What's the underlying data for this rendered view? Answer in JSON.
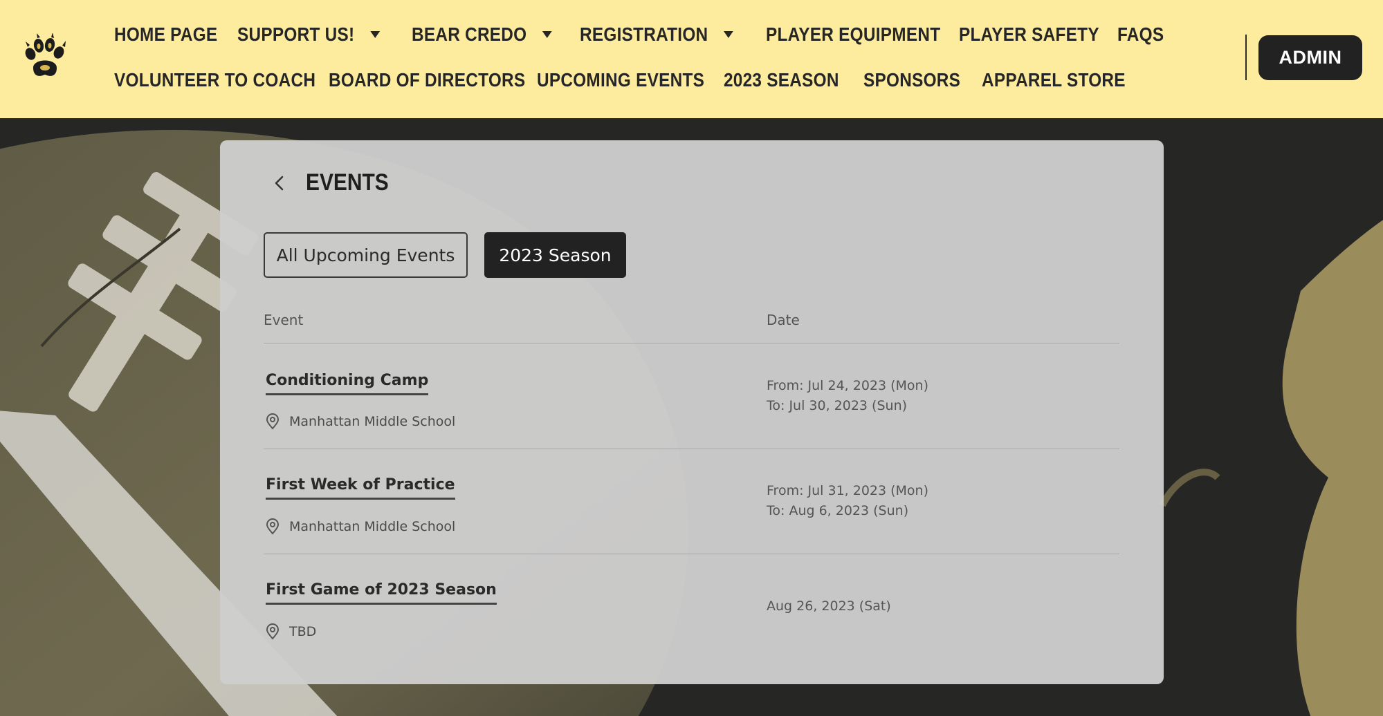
{
  "nav": {
    "row1": [
      {
        "label": "HOME PAGE",
        "dropdown": false
      },
      {
        "label": "SUPPORT US!",
        "dropdown": true
      },
      {
        "label": "BEAR CREDO",
        "dropdown": true
      },
      {
        "label": "REGISTRATION",
        "dropdown": true
      },
      {
        "label": "PLAYER EQUIPMENT",
        "dropdown": false
      },
      {
        "label": "PLAYER SAFETY",
        "dropdown": false
      },
      {
        "label": "FAQS",
        "dropdown": false
      }
    ],
    "row2": [
      {
        "label": "VOLUNTEER TO COACH"
      },
      {
        "label": "BOARD OF DIRECTORS"
      },
      {
        "label": "UPCOMING EVENTS"
      },
      {
        "label": "2023 SEASON"
      },
      {
        "label": "SPONSORS"
      },
      {
        "label": "APPAREL STORE"
      }
    ],
    "admin_label": "ADMIN"
  },
  "events": {
    "title": "EVENTS",
    "tabs": [
      {
        "label": "All Upcoming Events",
        "active": false
      },
      {
        "label": "2023 Season",
        "active": true
      }
    ],
    "columns": {
      "event": "Event",
      "date": "Date"
    },
    "rows": [
      {
        "name": "Conditioning Camp",
        "location": "Manhattan Middle School",
        "date_from": "From: Jul 24, 2023 (Mon)",
        "date_to": "To: Jul 30, 2023 (Sun)"
      },
      {
        "name": "First Week of Practice",
        "location": "Manhattan Middle School",
        "date_from": "From: Jul 31, 2023 (Mon)",
        "date_to": "To: Aug 6, 2023 (Sun)"
      },
      {
        "name": "First Game of 2023 Season",
        "location": "TBD",
        "date_single": "Aug 26, 2023 (Sat)"
      }
    ]
  },
  "colors": {
    "header_bg": "#fdeb9e",
    "dark": "#222222",
    "card_bg": "#cecece",
    "gold": "#a89863"
  },
  "icons": [
    "bear-paw-logo-icon",
    "chevron-down-icon",
    "chevron-left-icon",
    "map-pin-icon"
  ]
}
